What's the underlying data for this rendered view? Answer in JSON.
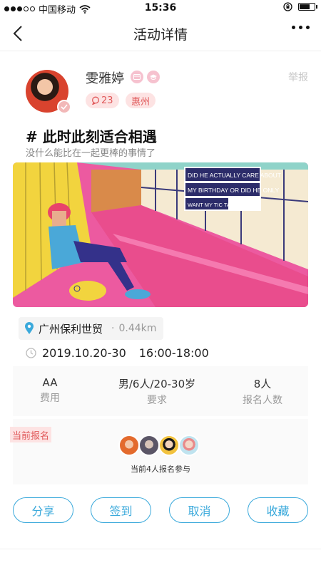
{
  "status_bar": {
    "carrier": "中国移动",
    "time": "15:36"
  },
  "nav": {
    "title": "活动详情",
    "back_icon": "chevron-left-icon",
    "more_icon": "more-dots-icon"
  },
  "profile": {
    "name": "雯雅婷",
    "report_label": "举报",
    "message_count": "23",
    "city": "惠州"
  },
  "activity": {
    "title": "# 此时此刻适合相遇",
    "subtitle": "没什么能比在一起更棒的事情了",
    "hero_caption_lines": [
      "DID HE ACTUALLY CARE ABOUT",
      "MY BIRTHDAY OR DID HE ONLY",
      "WANT MY TIC TACS?"
    ]
  },
  "location": {
    "name": "广州保利世贸",
    "separator": "·",
    "distance": "0.44km"
  },
  "time": {
    "date": "2019.10.20-30",
    "hours": "16:00-18:00"
  },
  "info": [
    {
      "value": "AA",
      "label": "费用"
    },
    {
      "value": "男/6人/20-30岁",
      "label": "要求"
    },
    {
      "value": "8人",
      "label": "报名人数"
    }
  ],
  "signup": {
    "label": "当前报名",
    "summary": "当前4人报名参与"
  },
  "actions": {
    "share": "分享",
    "checkin": "签到",
    "cancel": "取消",
    "favorite": "收藏"
  },
  "colors": {
    "accent_blue": "#3aa9db",
    "tag_pink_bg": "#fde3e3",
    "tag_pink_text": "#e0595a"
  }
}
